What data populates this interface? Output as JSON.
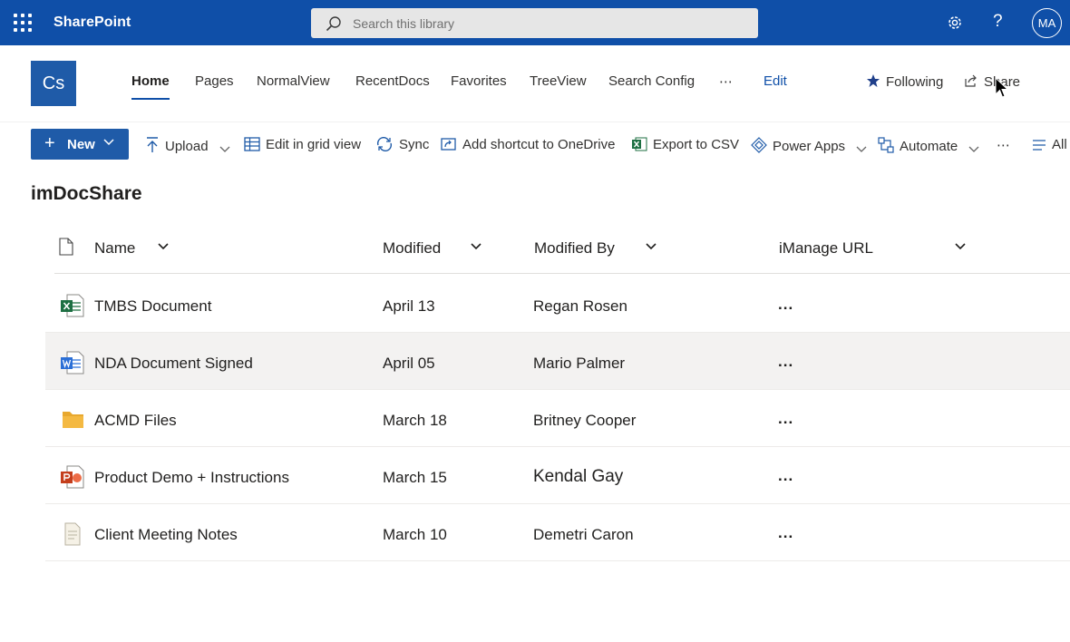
{
  "suite": {
    "app_name": "SharePoint",
    "search_placeholder": "Search this library",
    "help_glyph": "?",
    "avatar_initials": "MA"
  },
  "site": {
    "logo_text": "Cs",
    "nav": [
      "Home",
      "Pages",
      "NormalView",
      "RecentDocs",
      "Favorites",
      "TreeView",
      "Search Config",
      "⋯",
      "Edit"
    ],
    "following_label": "Following",
    "share_label": "Share"
  },
  "commands": {
    "new_label": "New",
    "upload_label": "Upload",
    "grid_label": "Edit in grid view",
    "sync_label": "Sync",
    "shortcut_label": "Add shortcut to OneDrive",
    "csv_label": "Export to CSV",
    "powerapps_label": "Power Apps",
    "automate_label": "Automate",
    "more_glyph": "⋯",
    "view_label": "All"
  },
  "library": {
    "title": "imDocShare",
    "columns": [
      "Name",
      "Modified",
      "Modified By",
      "iManage URL"
    ],
    "rows": [
      {
        "type": "excel",
        "name": "TMBS Document",
        "modified": "April 13",
        "modified_by": "Regan Rosen",
        "url": "..."
      },
      {
        "type": "word",
        "name": "NDA Document Signed",
        "modified": "April 05",
        "modified_by": "Mario Palmer",
        "url": "..."
      },
      {
        "type": "folder",
        "name": "ACMD Files",
        "modified": "March 18",
        "modified_by": "Britney Cooper",
        "url": "..."
      },
      {
        "type": "powerpoint",
        "name": "Product Demo + Instructions",
        "modified": "March 15",
        "modified_by": "Kendal Gay",
        "url": "..."
      },
      {
        "type": "text",
        "name": "Client Meeting Notes",
        "modified": "March 10",
        "modified_by": "Demetri Caron",
        "url": "..."
      }
    ]
  },
  "colors": {
    "suite_bar": "#0f4fa8",
    "accent": "#1f5ba8",
    "selected_row": "#f3f2f1"
  }
}
